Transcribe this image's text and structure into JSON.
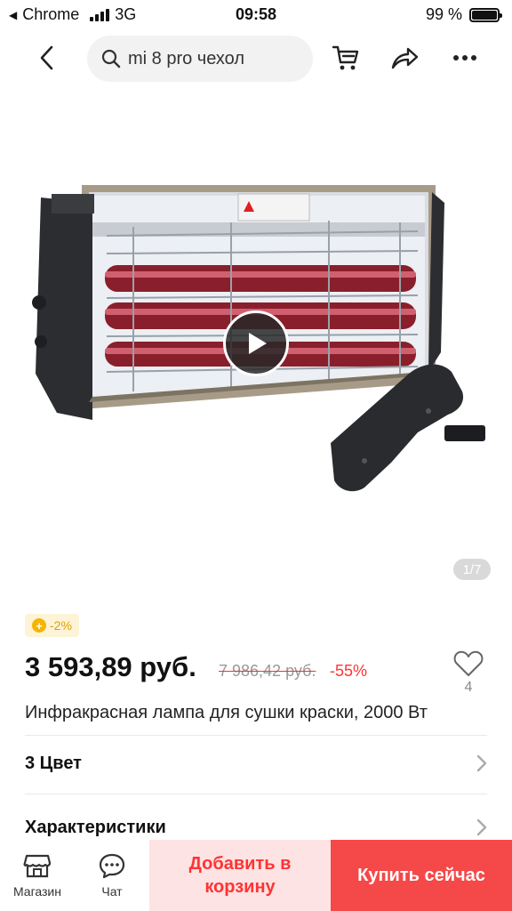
{
  "status_bar": {
    "carrier": "Chrome",
    "network": "3G",
    "time": "09:58",
    "battery": "99 %",
    "battery_level": 0.99
  },
  "navbar": {
    "search_text": "mi 8 pro чехол",
    "icons": [
      "back-icon",
      "search-icon",
      "cart-icon",
      "share-icon",
      "more-icon"
    ]
  },
  "gallery": {
    "counter": "1/7",
    "icons": [
      "play-icon"
    ]
  },
  "product": {
    "coin_badge": "-2%",
    "price": "3 593,89 руб.",
    "old_price": "7 986,42 руб.",
    "discount": "-55%",
    "wishlist_count": "4",
    "title": "Инфракрасная лампа для сушки краски, 2000 Вт"
  },
  "rows": {
    "color": "3 Цвет",
    "specs": "Характеристики"
  },
  "bottom_bar": {
    "store_label": "Магазин",
    "chat_label": "Чат",
    "add_to_cart": "Добавить в корзину",
    "buy_now": "Купить сейчас"
  },
  "colors": {
    "accent_red": "#f54848",
    "add_cart_bg": "#fde3e3",
    "discount_red": "#f33333",
    "coin_yellow": "#f5b400"
  }
}
